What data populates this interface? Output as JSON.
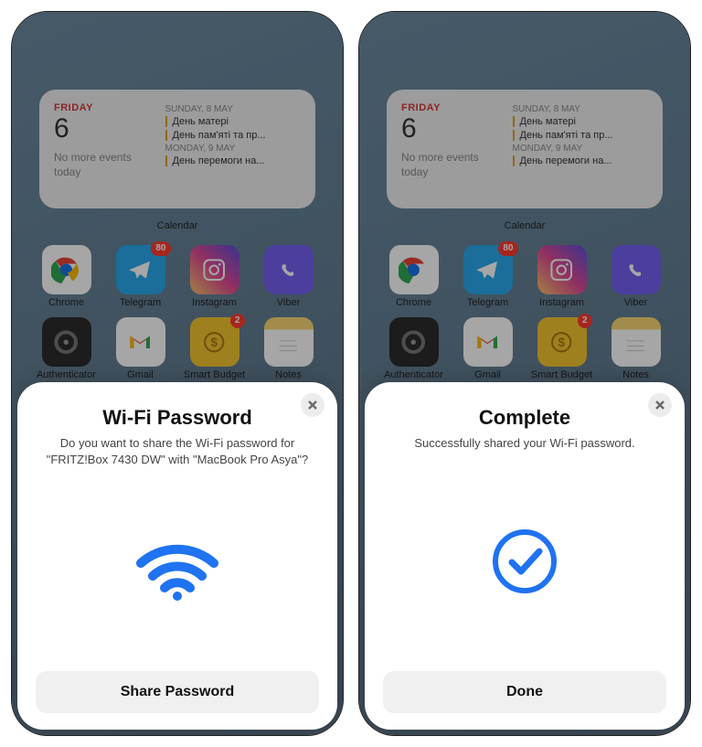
{
  "colors": {
    "accent": "#1f73f1",
    "badge": "#ff3b30",
    "event_bar": "#e0a020"
  },
  "calendar": {
    "left_day_label": "FRIDAY",
    "left_day_num": "6",
    "no_events": "No more events today",
    "right": [
      {
        "hdr": "SUNDAY, 8 MAY",
        "events": [
          "День матері",
          "День пам'яті та пр..."
        ]
      },
      {
        "hdr": "MONDAY, 9 MAY",
        "events": [
          "День перемоги на..."
        ]
      }
    ],
    "widget_label": "Calendar"
  },
  "apps_row1": [
    {
      "name": "Chrome",
      "badge": null
    },
    {
      "name": "Telegram",
      "badge": "80"
    },
    {
      "name": "Instagram",
      "badge": null
    },
    {
      "name": "Viber",
      "badge": null
    }
  ],
  "apps_row2": [
    {
      "name": "Authenticator",
      "badge": null
    },
    {
      "name": "Gmail",
      "badge": null
    },
    {
      "name": "Smart Budget",
      "badge": "2"
    },
    {
      "name": "Notes",
      "badge": null
    }
  ],
  "sheet_left": {
    "title": "Wi-Fi Password",
    "body": "Do you want to share the Wi-Fi password for \"FRITZ!Box 7430 DW\" with \"MacBook Pro Asya\"?",
    "button": "Share Password"
  },
  "sheet_right": {
    "title": "Complete",
    "body": "Successfully shared your Wi-Fi password.",
    "button": "Done"
  }
}
